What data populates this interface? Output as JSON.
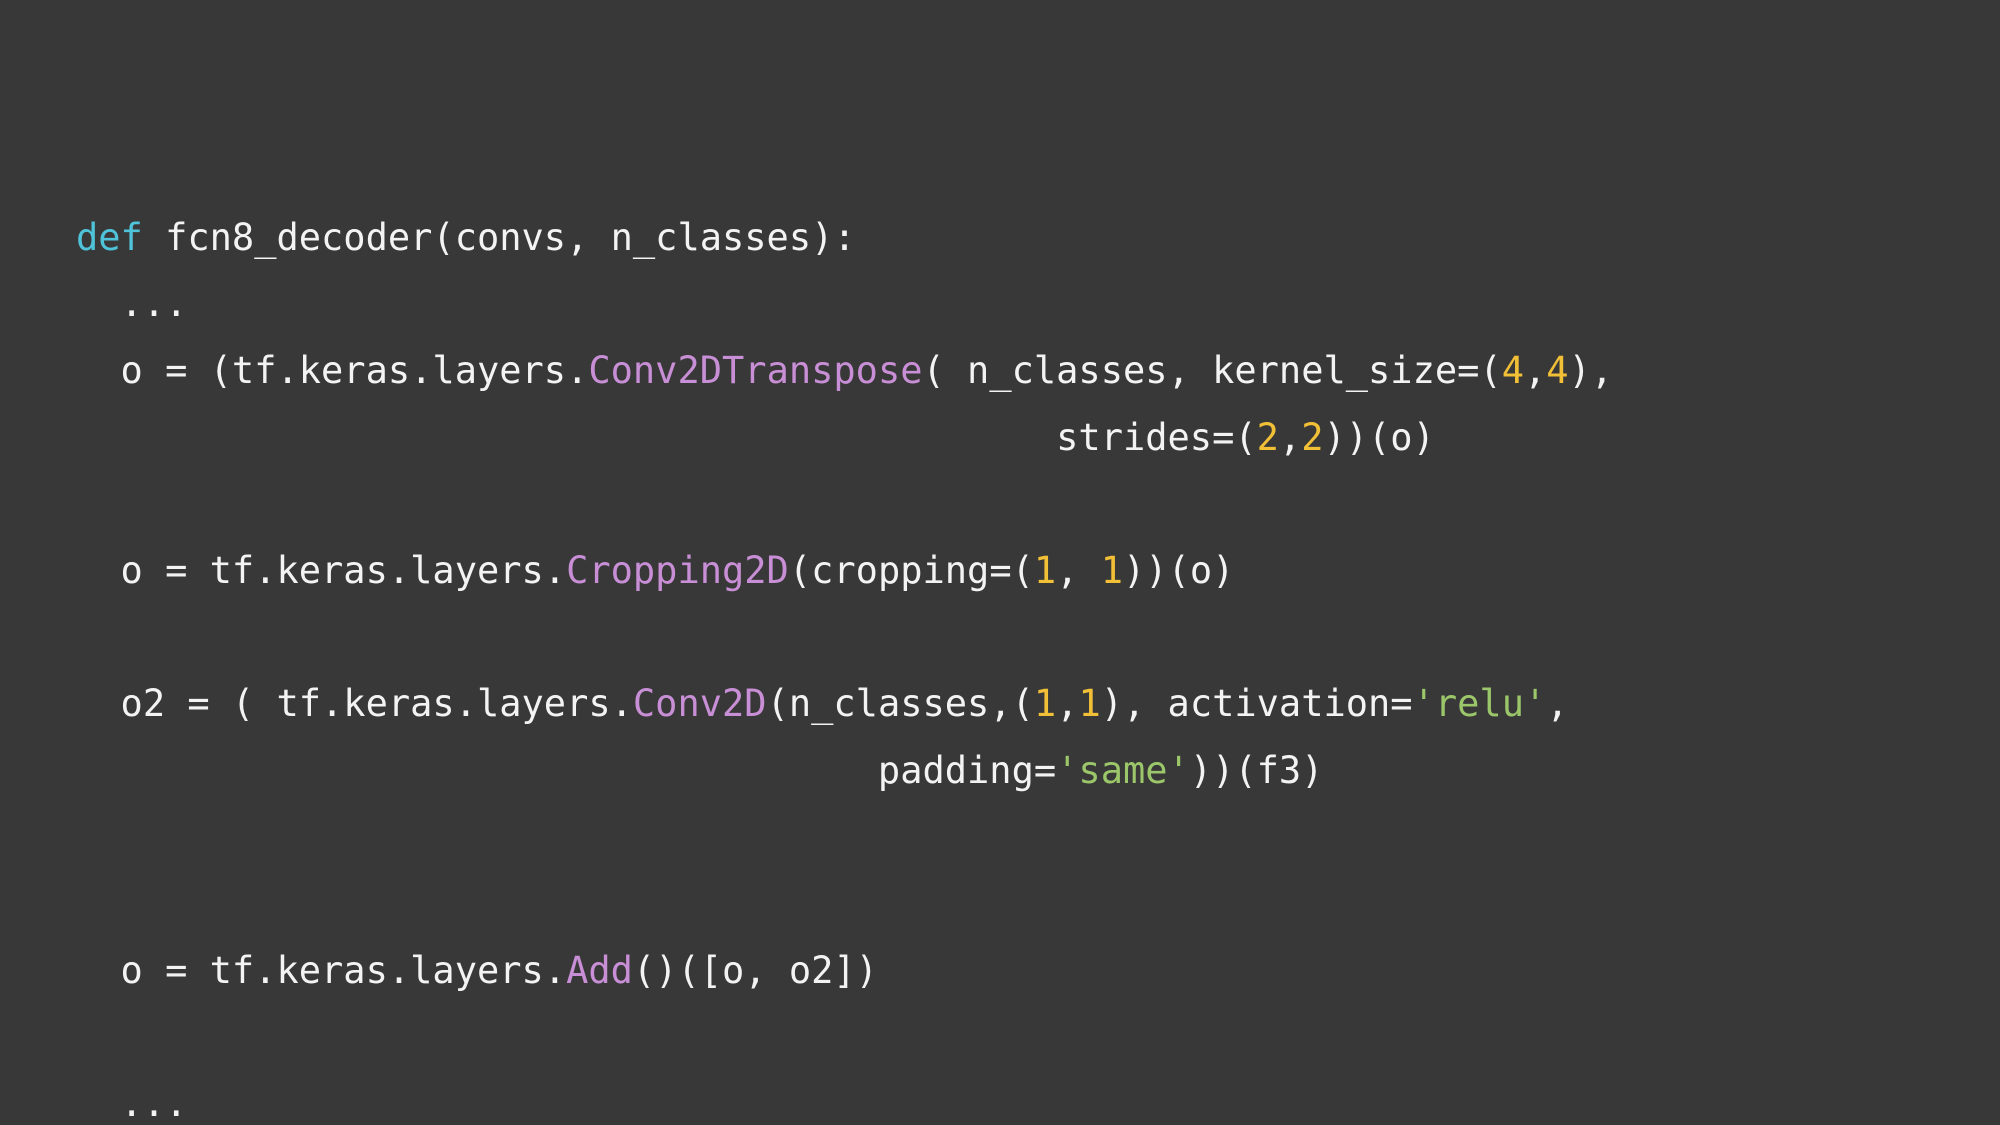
{
  "colors": {
    "background": "#383838",
    "text": "#f3f3f3",
    "keyword": "#4fc3d9",
    "function": "#c98fd6",
    "number": "#f2c037",
    "string": "#9bc76a"
  },
  "code": {
    "l1": {
      "kw": "def",
      "rest": " fcn8_decoder(convs, n_classes):"
    },
    "l2": {
      "text": "  ..."
    },
    "l3": {
      "a": "  o = (tf.keras.layers.",
      "fn": "Conv2DTranspose",
      "b": "( n_classes, kernel_size=(",
      "n1": "4",
      "c": ",",
      "n2": "4",
      "d": "),"
    },
    "l4": {
      "a": "                                            strides=(",
      "n1": "2",
      "b": ",",
      "n2": "2",
      "c": "))(o)"
    },
    "l5": {
      "a": "  o = tf.keras.layers.",
      "fn": "Cropping2D",
      "b": "(cropping=(",
      "n1": "1",
      "c": ", ",
      "n2": "1",
      "d": "))(o)"
    },
    "l6": {
      "a": "  o2 = ( tf.keras.layers.",
      "fn": "Conv2D",
      "b": "(n_classes,(",
      "n1": "1",
      "c": ",",
      "n2": "1",
      "d": "), activation=",
      "s": "'relu'",
      "e": ","
    },
    "l7": {
      "a": "                                    padding=",
      "s": "'same'",
      "b": "))(f3)"
    },
    "l8": {
      "a": "  o = tf.keras.layers.",
      "fn": "Add",
      "b": "()([o, o2])"
    },
    "l9": {
      "text": "  ..."
    }
  }
}
